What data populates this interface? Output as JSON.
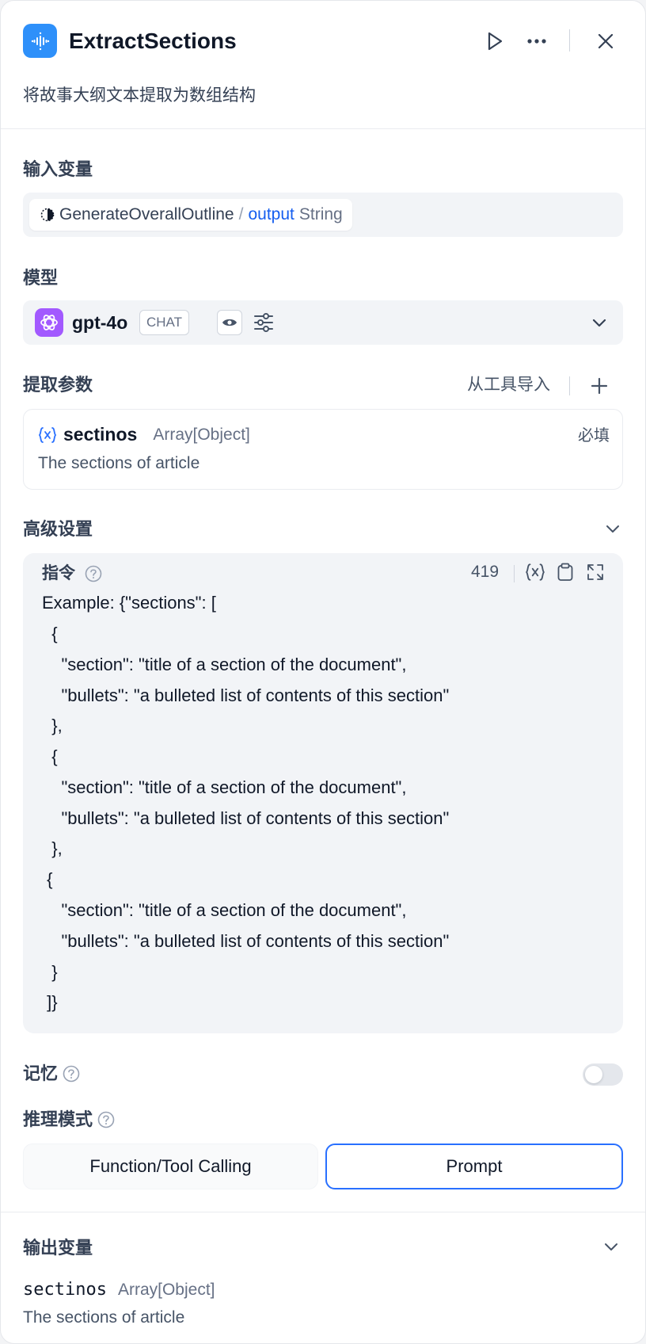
{
  "header": {
    "title": "ExtractSections",
    "description": "将故事大纲文本提取为数组结构",
    "icons": {
      "app": "extractor-icon",
      "run": "play-icon",
      "more": "more-icon",
      "close": "close-icon"
    }
  },
  "input_vars": {
    "label": "输入变量",
    "node": "GenerateOverallOutline",
    "separator": "/",
    "var": "output",
    "type": "String"
  },
  "model": {
    "label": "模型",
    "name": "gpt-4o",
    "mode_tag": "CHAT",
    "icons": {
      "vision": "eye-icon",
      "settings": "sliders-icon",
      "dropdown": "chevron-down-icon"
    }
  },
  "params": {
    "label": "提取参数",
    "import_label": "从工具导入",
    "items": [
      {
        "name": "sectinos",
        "type": "Array[Object]",
        "description": "The sections of article",
        "required": "必填"
      }
    ]
  },
  "advanced": {
    "label": "高级设置",
    "instruction": {
      "label": "指令",
      "count": "419",
      "lines": [
        "Example: {\"sections\": [",
        "  {",
        "    \"section\": \"title of a section of the document\",",
        "    \"bullets\": \"a bulleted list of contents of this section\"",
        "  },",
        "  {",
        "    \"section\": \"title of a section of the document\",",
        "    \"bullets\": \"a bulleted list of contents of this section\"",
        "  },",
        " {",
        "    \"section\": \"title of a section of the document\",",
        "    \"bullets\": \"a bulleted list of contents of this section\"",
        "  }",
        " ]}"
      ]
    },
    "memory_label": "记忆",
    "memory_enabled": false,
    "reasoning_label": "推理模式",
    "reasoning_options": [
      "Function/Tool Calling",
      "Prompt"
    ],
    "reasoning_selected": "Prompt"
  },
  "output": {
    "label": "输出变量",
    "items": [
      {
        "name": "sectinos",
        "type": "Array[Object]",
        "description": "The sections of article"
      }
    ]
  },
  "colors": {
    "accent": "#2970ff",
    "app_icon": "#2e90fa",
    "model_icon": "#a259ff"
  }
}
